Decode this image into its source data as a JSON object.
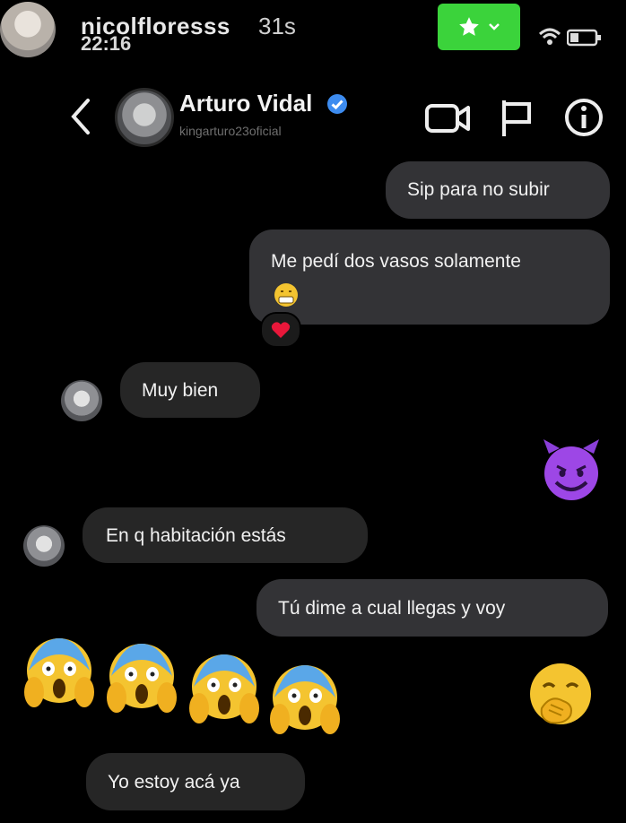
{
  "story": {
    "username": "nicolfloresss",
    "time_overlay": "22:16",
    "age": "31s"
  },
  "header": {
    "contact_name": "Arturo Vidal",
    "handle": "kingarturo23oficial",
    "icons": [
      "back-icon",
      "video-call-icon",
      "flag-icon",
      "info-icon"
    ]
  },
  "messages": [
    {
      "side": "out",
      "text": "Sip para no subir"
    },
    {
      "side": "out",
      "text": "Me pedí dos vasos solamente",
      "emoji": "grimace-face"
    },
    {
      "side": "in",
      "text": "Muy bien"
    },
    {
      "side": "out",
      "emoji": "smiling-imp"
    },
    {
      "side": "in",
      "text": "En q habitación estás"
    },
    {
      "side": "out",
      "text": "Tú dime a cual llegas y voy"
    },
    {
      "side": "in",
      "emoji": [
        "face-screaming",
        "face-screaming",
        "face-screaming",
        "face-screaming"
      ]
    },
    {
      "side": "out",
      "emoji": "face-with-hand-over-mouth"
    },
    {
      "side": "in",
      "text": "Yo estoy acá ya"
    }
  ],
  "reaction": {
    "emoji": "red-heart"
  },
  "colors": {
    "background": "#000000",
    "bubble_in": "#262626",
    "bubble_out": "#333336",
    "verified": "#3d8cf0",
    "green_button": "#3bd33b"
  }
}
